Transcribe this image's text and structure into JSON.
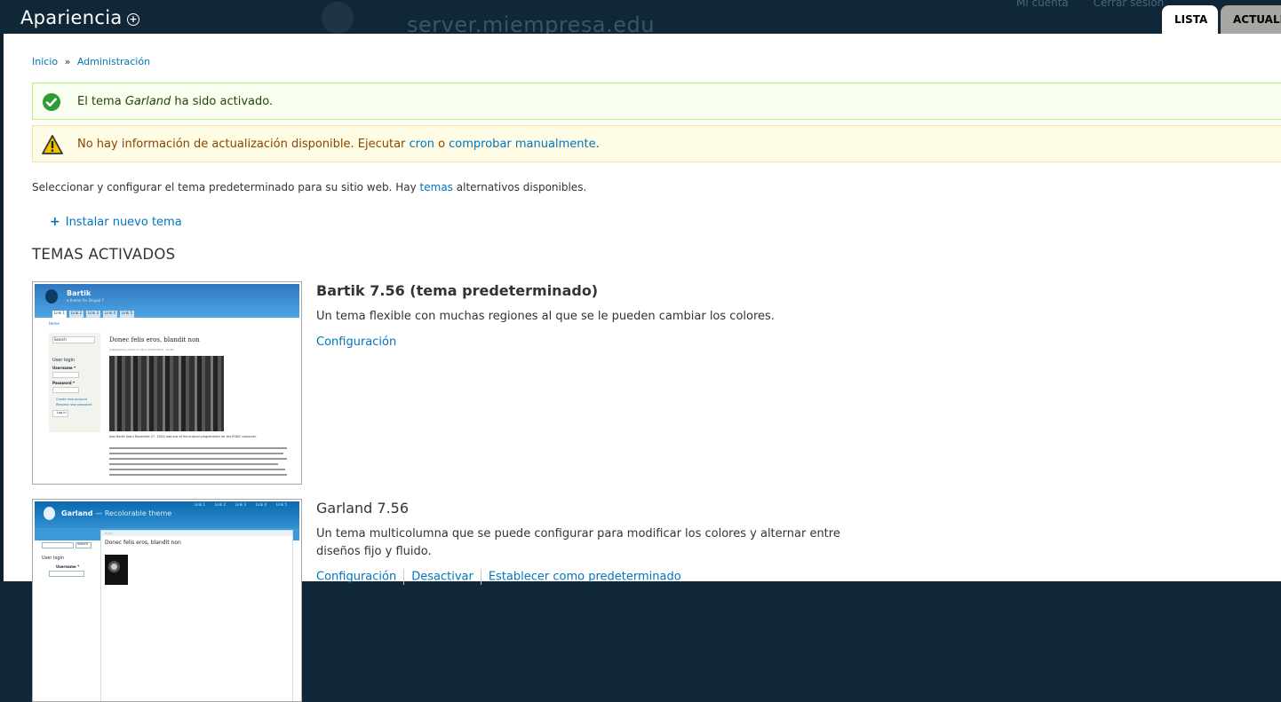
{
  "overlay": {
    "title": "Apariencia",
    "background_site_name": "server.miempresa.edu",
    "background_links": [
      "Mi cuenta",
      "Cerrar sesión"
    ],
    "tabs": [
      {
        "label": "LISTA",
        "active": true
      },
      {
        "label": "ACTUALI",
        "active": false
      }
    ]
  },
  "breadcrumb": {
    "items": [
      "Inicio",
      "Administración"
    ],
    "separator": "»"
  },
  "messages": {
    "status": {
      "prefix": "El tema ",
      "theme": "Garland",
      "suffix": " ha sido activado."
    },
    "warning": {
      "prefix": "No hay información de actualización disponible. Ejecutar ",
      "link_cron": "cron",
      "middle": " o ",
      "link_check": "comprobar manualmente",
      "suffix": "."
    }
  },
  "description": {
    "prefix": "Seleccionar y configurar el tema predeterminado para su sitio web. Hay ",
    "link": "temas",
    "suffix": " alternativos disponibles."
  },
  "install_link": "Instalar nuevo tema",
  "section_title": "TEMAS ACTIVADOS",
  "themes": [
    {
      "name": "Bartik 7.56 (tema predeterminado)",
      "description": "Un tema flexible con muchas regiones al que se le pueden cambiar los colores.",
      "links": [
        "Configuración"
      ],
      "screenshot": {
        "site_name": "Bartik",
        "slogan": "a theme for Drupal 7",
        "tabs": [
          "Link 1",
          "Link 2",
          "Link 3",
          "Link 4",
          "Link 5"
        ],
        "home": "Home",
        "search": "Search",
        "user_login": "User login",
        "username": "Username *",
        "password": "Password *",
        "create_account": "Create new account",
        "request_password": "Request new password",
        "login_button": "Log in",
        "post_title": "Donec felis eros, blandit non",
        "meta": "published by admin on Mon, 07/05/2010 - 10:52",
        "caption": "Jean Bartik (born December 27, 1924) was one of the original programmers for the ENIAC computer."
      }
    },
    {
      "name": "Garland 7.56",
      "description": "Un tema multicolumna que se puede configurar para modificar los colores y alternar entre diseños fijo y fluido.",
      "links": [
        "Configuración",
        "Desactivar",
        "Establecer como predeterminado"
      ],
      "screenshot": {
        "site_name": "Garland",
        "slogan": "— Recolorable theme",
        "tabs": [
          "Link 1",
          "Link 2",
          "Link 3",
          "Link 4",
          "Link 5"
        ],
        "search_button": "Search",
        "user_login": "User login",
        "username": "Username *",
        "home": "Home",
        "post_title": "Donec felis eros, blandit non"
      }
    }
  ],
  "colors": {
    "overlay_bg": "#0f2736",
    "link": "#0074bd",
    "status_bg": "#f8fff0",
    "status_border": "#bbee77",
    "warning_bg": "#fffce5",
    "warning_border": "#ede9a5",
    "success_icon": "#2f9b36",
    "warning_icon": "#f3c300"
  },
  "icons": {
    "status": "check-circle-icon",
    "warning": "warning-triangle-icon",
    "shortcut": "add-shortcut-icon",
    "install": "plus-icon"
  }
}
